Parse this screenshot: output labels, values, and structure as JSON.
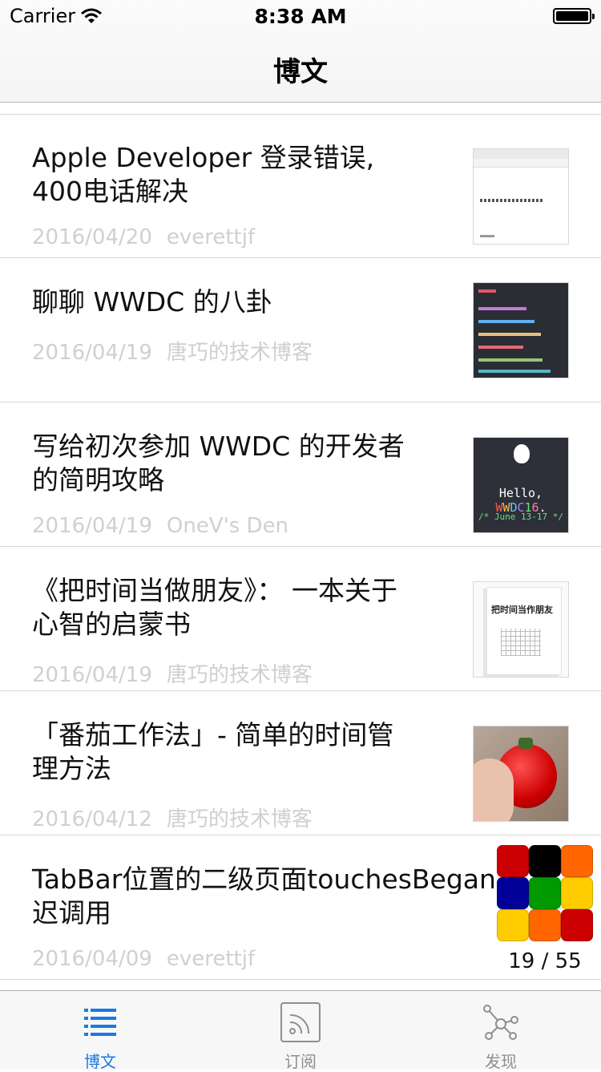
{
  "status_bar": {
    "carrier": "Carrier",
    "time": "8:38 AM"
  },
  "nav": {
    "title": "博文"
  },
  "articles": [
    {
      "title_lines": [
        "Apple Developer 登录错误,",
        "400电话解决"
      ],
      "date": "2016/04/20",
      "author": "everettjf",
      "thumb": "web-screenshot"
    },
    {
      "title_lines": [
        "聊聊 WWDC 的八卦"
      ],
      "date": "2016/04/19",
      "author": "唐巧的技术博客",
      "thumb": "code-screenshot"
    },
    {
      "title_lines": [
        "写给初次参加 WWDC 的开发者",
        "的简明攻略"
      ],
      "date": "2016/04/19",
      "author": "OneV's Den",
      "thumb": "wwdc-poster"
    },
    {
      "title_lines": [
        "《把时间当做朋友》： 一本关于",
        "心智的启蒙书"
      ],
      "date": "2016/04/19",
      "author": "唐巧的技术博客",
      "thumb": "book-cover"
    },
    {
      "title_lines": [
        "「番茄工作法」- 简单的时间管",
        "理方法"
      ],
      "date": "2016/04/12",
      "author": "唐巧的技术博客",
      "thumb": "tomato-timer-photo"
    },
    {
      "title_lines": [
        "TabBar位置的二级页面touchesBegan",
        "迟调用"
      ],
      "date": "2016/04/09",
      "author": "everettjf",
      "thumb": null
    }
  ],
  "thumb_text": {
    "wwdc_hello": "Hello, WWDC16.",
    "wwdc_date": "/* June 13-17 */",
    "book_title": "把时间当作朋友"
  },
  "color_grid": {
    "colors": [
      "#cc0000",
      "#000000",
      "#ff6600",
      "#000099",
      "#009900",
      "#ffcc00",
      "#ffcc00",
      "#ff6600",
      "#cc0000"
    ]
  },
  "page_counter": "19 / 55",
  "tabs": [
    {
      "label": "博文",
      "icon": "list-icon",
      "active": true
    },
    {
      "label": "订阅",
      "icon": "rss-icon",
      "active": false
    },
    {
      "label": "发现",
      "icon": "network-icon",
      "active": false
    }
  ],
  "colors": {
    "accent": "#1a7ae0",
    "inactive": "#8e8e93",
    "meta": "#cfcfd4"
  }
}
